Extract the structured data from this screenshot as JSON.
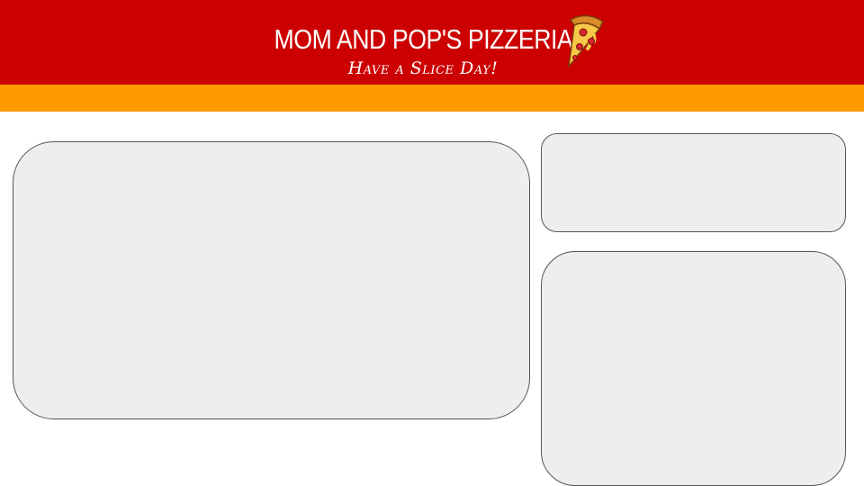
{
  "header": {
    "title": "MOM AND POP'S PIZZERIA",
    "tagline": "Have a Slice Day!",
    "logo_icon": "pizza-slice-icon"
  },
  "colors": {
    "header_red": "#cc0000",
    "accent_orange": "#ff9900",
    "panel_fill": "#eeeeee",
    "panel_border": "#555555"
  }
}
